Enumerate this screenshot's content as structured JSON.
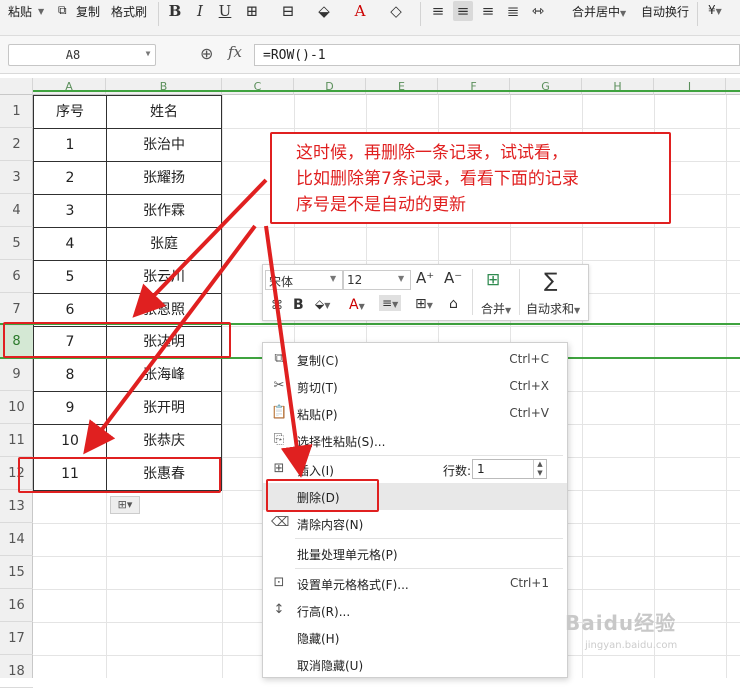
{
  "ribbon": {
    "paste": "粘贴",
    "copy": "复制",
    "format_painter": "格式刷",
    "merge_center": "合并居中",
    "wrap_text": "自动换行"
  },
  "formula_bar": {
    "cell_ref": "A8",
    "formula": "=ROW()-1"
  },
  "columns": [
    "A",
    "B",
    "C",
    "D",
    "E",
    "F",
    "G",
    "H",
    "I"
  ],
  "rows": [
    "1",
    "2",
    "3",
    "4",
    "5",
    "6",
    "7",
    "8",
    "9",
    "10",
    "11",
    "12",
    "13",
    "14",
    "15",
    "16",
    "17",
    "18"
  ],
  "selected_row": "8",
  "table": {
    "headers": [
      "序号",
      "姓名"
    ],
    "rows": [
      [
        "1",
        "张治中"
      ],
      [
        "2",
        "张耀扬"
      ],
      [
        "3",
        "张作霖"
      ],
      [
        "4",
        "张庭"
      ],
      [
        "5",
        "张云川"
      ],
      [
        "6",
        "张恩照"
      ],
      [
        "7",
        "张达明"
      ],
      [
        "8",
        "张海峰"
      ],
      [
        "9",
        "张开明"
      ],
      [
        "10",
        "张恭庆"
      ],
      [
        "11",
        "张惠春"
      ]
    ]
  },
  "mini_toolbar": {
    "font_name": "宋体",
    "font_size": "12",
    "merge": "合并",
    "autosum": "自动求和"
  },
  "context_menu": {
    "items": [
      {
        "label": "复制(C)",
        "shortcut": "Ctrl+C",
        "icon": "copy-icon"
      },
      {
        "label": "剪切(T)",
        "shortcut": "Ctrl+X",
        "icon": "scissors-icon"
      },
      {
        "label": "粘贴(P)",
        "shortcut": "Ctrl+V",
        "icon": "paste-icon"
      },
      {
        "label": "选择性粘贴(S)...",
        "shortcut": "",
        "icon": "paste-special-icon"
      },
      {
        "label": "插入(I)",
        "shortcut": "",
        "icon": "insert-icon"
      },
      {
        "label": "删除(D)",
        "shortcut": "",
        "icon": ""
      },
      {
        "label": "清除内容(N)",
        "shortcut": "",
        "icon": "eraser-icon"
      },
      {
        "label": "批量处理单元格(P)",
        "shortcut": "",
        "icon": ""
      },
      {
        "label": "设置单元格格式(F)...",
        "shortcut": "Ctrl+1",
        "icon": "format-cells-icon"
      },
      {
        "label": "行高(R)...",
        "shortcut": "",
        "icon": "row-height-icon"
      },
      {
        "label": "隐藏(H)",
        "shortcut": "",
        "icon": ""
      },
      {
        "label": "取消隐藏(U)",
        "shortcut": "",
        "icon": ""
      }
    ],
    "row_count_label": "行数:",
    "row_count_value": "1"
  },
  "annotation": {
    "lines": [
      "这时候，再删除一条记录，试试看，",
      "比如删除第7条记录，看看下面的记录",
      "序号是不是自动的更新"
    ]
  },
  "colors": {
    "annotation_red": "#e02020",
    "selection_green": "#3fa33f"
  },
  "watermark": {
    "text": "Baidu经验",
    "subtext": "jingyan.baidu.com"
  }
}
